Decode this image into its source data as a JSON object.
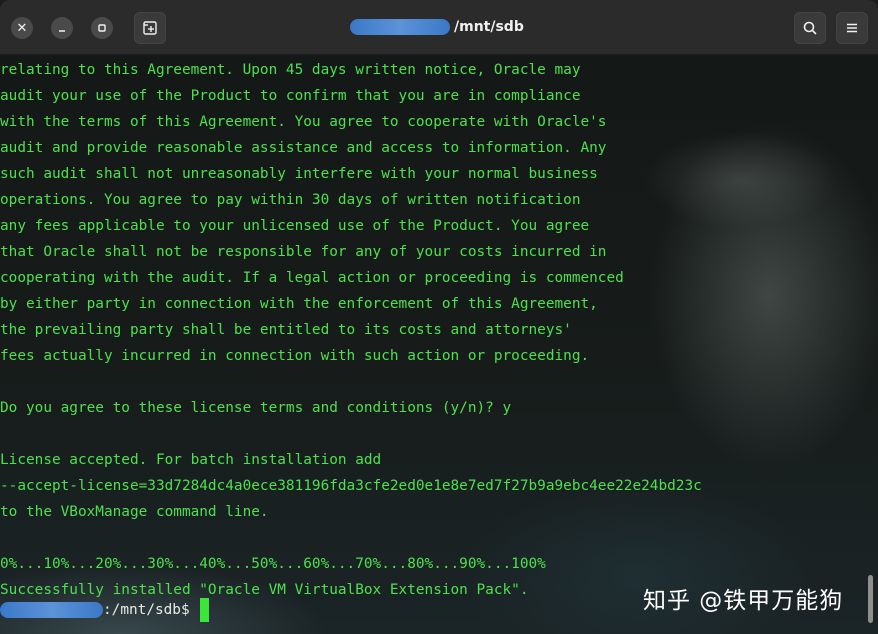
{
  "window": {
    "title_path": "/mnt/sdb",
    "buttons": {
      "close_icon": "close-icon",
      "minimize_icon": "minimize-icon",
      "maximize_icon": "maximize-icon",
      "new_tab_icon": "new-tab-icon",
      "search_icon": "search-icon",
      "menu_icon": "hamburger-menu-icon"
    }
  },
  "terminal": {
    "text_color": "#4ee04e",
    "lines": [
      "relating to this Agreement. Upon 45 days written notice, Oracle may",
      "audit your use of the Product to confirm that you are in compliance",
      "with the terms of this Agreement. You agree to cooperate with Oracle's",
      "audit and provide reasonable assistance and access to information. Any",
      "such audit shall not unreasonably interfere with your normal business",
      "operations. You agree to pay within 30 days of written notification",
      "any fees applicable to your unlicensed use of the Product. You agree",
      "that Oracle shall not be responsible for any of your costs incurred in",
      "cooperating with the audit. If a legal action or proceeding is commenced",
      "by either party in connection with the enforcement of this Agreement,",
      "the prevailing party shall be entitled to its costs and attorneys'",
      "fees actually incurred in connection with such action or proceeding.",
      "",
      "Do you agree to these license terms and conditions (y/n)? y",
      "",
      "License accepted. For batch installation add",
      "--accept-license=33d7284dc4a0ece381196fda3cfe2ed0e1e8e7ed7f27b9a9ebc4ee22e24bd23c",
      "to the VBoxManage command line.",
      "",
      "0%...10%...20%...30%...40%...50%...60%...70%...80%...90%...100%",
      "Successfully installed \"Oracle VM VirtualBox Extension Pack\"."
    ],
    "prompt_suffix": ":/mnt/sdb$ "
  },
  "watermark": "知乎 @铁甲万能狗"
}
